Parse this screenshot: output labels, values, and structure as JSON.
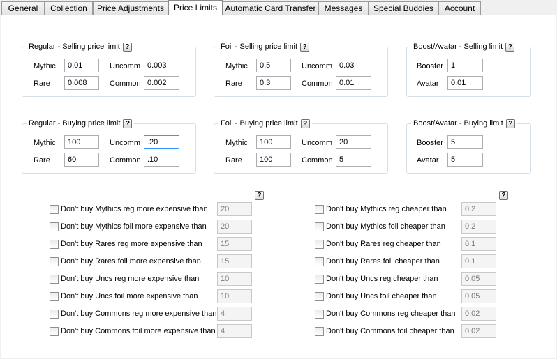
{
  "tabs": [
    "General",
    "Collection",
    "Price Adjustments",
    "Price Limits",
    "Automatic Card Transfer",
    "Messages",
    "Special Buddies",
    "Account"
  ],
  "active_tab": "Price Limits",
  "help_glyph": "?",
  "groups": {
    "reg_sell": {
      "title": "Regular - Selling price limit",
      "labels": [
        "Mythic",
        "Uncomm",
        "Rare",
        "Common"
      ],
      "values": [
        "0.01",
        "0.003",
        "0.008",
        "0.002"
      ]
    },
    "foil_sell": {
      "title": "Foil - Selling price limit",
      "labels": [
        "Mythic",
        "Uncomm",
        "Rare",
        "Common"
      ],
      "values": [
        "0.5",
        "0.03",
        "0.3",
        "0.01"
      ]
    },
    "boost_sell": {
      "title": "Boost/Avatar - Selling limit",
      "labels": [
        "Booster",
        "Avatar"
      ],
      "values": [
        "1",
        "0.01"
      ]
    },
    "reg_buy": {
      "title": "Regular - Buying price limit",
      "labels": [
        "Mythic",
        "Uncomm",
        "Rare",
        "Common"
      ],
      "values": [
        "100",
        ".20",
        "60",
        ".10"
      ]
    },
    "foil_buy": {
      "title": "Foil - Buying price limit",
      "labels": [
        "Mythic",
        "Uncomm",
        "Rare",
        "Common"
      ],
      "values": [
        "100",
        "20",
        "100",
        "5"
      ]
    },
    "boost_buy": {
      "title": "Boost/Avatar - Buying limit",
      "labels": [
        "Booster",
        "Avatar"
      ],
      "values": [
        "5",
        "5"
      ]
    }
  },
  "expensive": [
    {
      "label": "Don't buy Mythics reg more expensive than",
      "value": "20"
    },
    {
      "label": "Don't buy Mythics foil more expensive than",
      "value": "20"
    },
    {
      "label": "Don't buy Rares reg more expensive than",
      "value": "15"
    },
    {
      "label": "Don't buy Rares foil more expensive than",
      "value": "15"
    },
    {
      "label": "Don't buy Uncs reg more expensive than",
      "value": "10"
    },
    {
      "label": "Don't buy Uncs foil more expensive than",
      "value": "10"
    },
    {
      "label": "Don't buy Commons reg more expensive than",
      "value": "4"
    },
    {
      "label": "Don't buy Commons foil more expensive than",
      "value": "4"
    }
  ],
  "cheaper": [
    {
      "label": "Don't buy Mythics reg cheaper than",
      "value": "0.2"
    },
    {
      "label": "Don't buy Mythics foil cheaper than",
      "value": "0.2"
    },
    {
      "label": "Don't buy Rares reg cheaper than",
      "value": "0.1"
    },
    {
      "label": "Don't buy Rares foil cheaper than",
      "value": "0.1"
    },
    {
      "label": "Don't buy Uncs reg cheaper than",
      "value": "0.05"
    },
    {
      "label": "Don't buy Uncs foil cheaper than",
      "value": "0.05"
    },
    {
      "label": "Don't buy Commons reg cheaper than",
      "value": "0.02"
    },
    {
      "label": "Don't buy Commons foil cheaper than",
      "value": "0.02"
    }
  ]
}
